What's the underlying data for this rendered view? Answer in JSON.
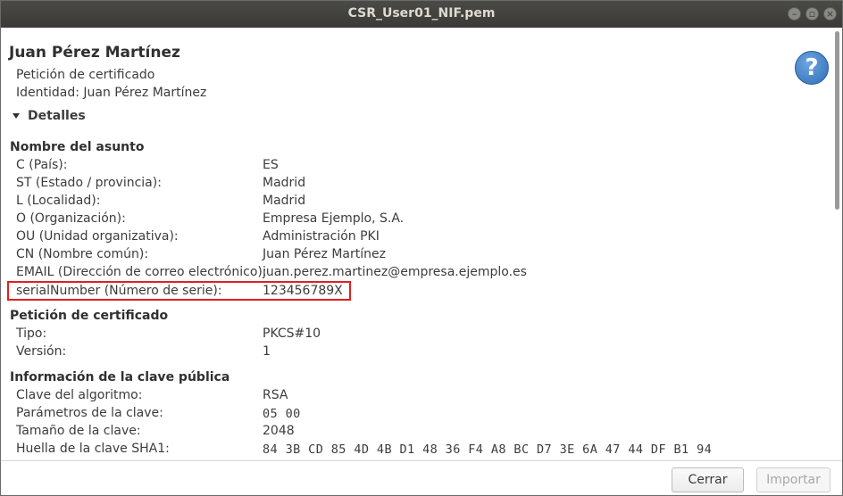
{
  "window": {
    "title": "CSR_User01_NIF.pem"
  },
  "header": {
    "name": "Juan Pérez Martínez",
    "type_line": "Petición de certificado",
    "identity_line": "Identidad: Juan Pérez Martínez",
    "details_toggle": "Detalles",
    "help_glyph": "?"
  },
  "subject": {
    "title": "Nombre del asunto",
    "rows": [
      {
        "label": "C (País):",
        "value": "ES"
      },
      {
        "label": "ST (Estado / provincia):",
        "value": "Madrid"
      },
      {
        "label": "L (Localidad):",
        "value": "Madrid"
      },
      {
        "label": "O (Organización):",
        "value": "Empresa Ejemplo, S.A."
      },
      {
        "label": "OU (Unidad organizativa):",
        "value": "Administración PKI"
      },
      {
        "label": "CN (Nombre común):",
        "value": "Juan Pérez Martínez"
      },
      {
        "label": "EMAIL (Dirección de correo electrónico):",
        "value": "juan.perez.martinez@empresa.ejemplo.es"
      },
      {
        "label": "serialNumber (Número de serie):",
        "value": "123456789X"
      }
    ]
  },
  "request": {
    "title": "Petición de certificado",
    "rows": [
      {
        "label": "Tipo:",
        "value": "PKCS#10"
      },
      {
        "label": "Versión:",
        "value": "1"
      }
    ]
  },
  "public_key": {
    "title": "Información de la clave pública",
    "rows": [
      {
        "label": "Clave del algoritmo:",
        "value": "RSA"
      },
      {
        "label": "Parámetros de la clave:",
        "value": "05 00"
      },
      {
        "label": "Tamaño de la clave:",
        "value": "2048"
      },
      {
        "label": "Huella de la clave SHA1:",
        "value": "84 3B CD 85 4D 4B D1 48 36 F4 A8 BC D7 3E 6A 47 44 DF B1 94"
      }
    ]
  },
  "footer": {
    "close_label": "Cerrar",
    "import_label": "Importar"
  },
  "colors": {
    "highlight": "#e02020",
    "help": "#2e6cb8",
    "titlebar": "#3b3a37"
  }
}
